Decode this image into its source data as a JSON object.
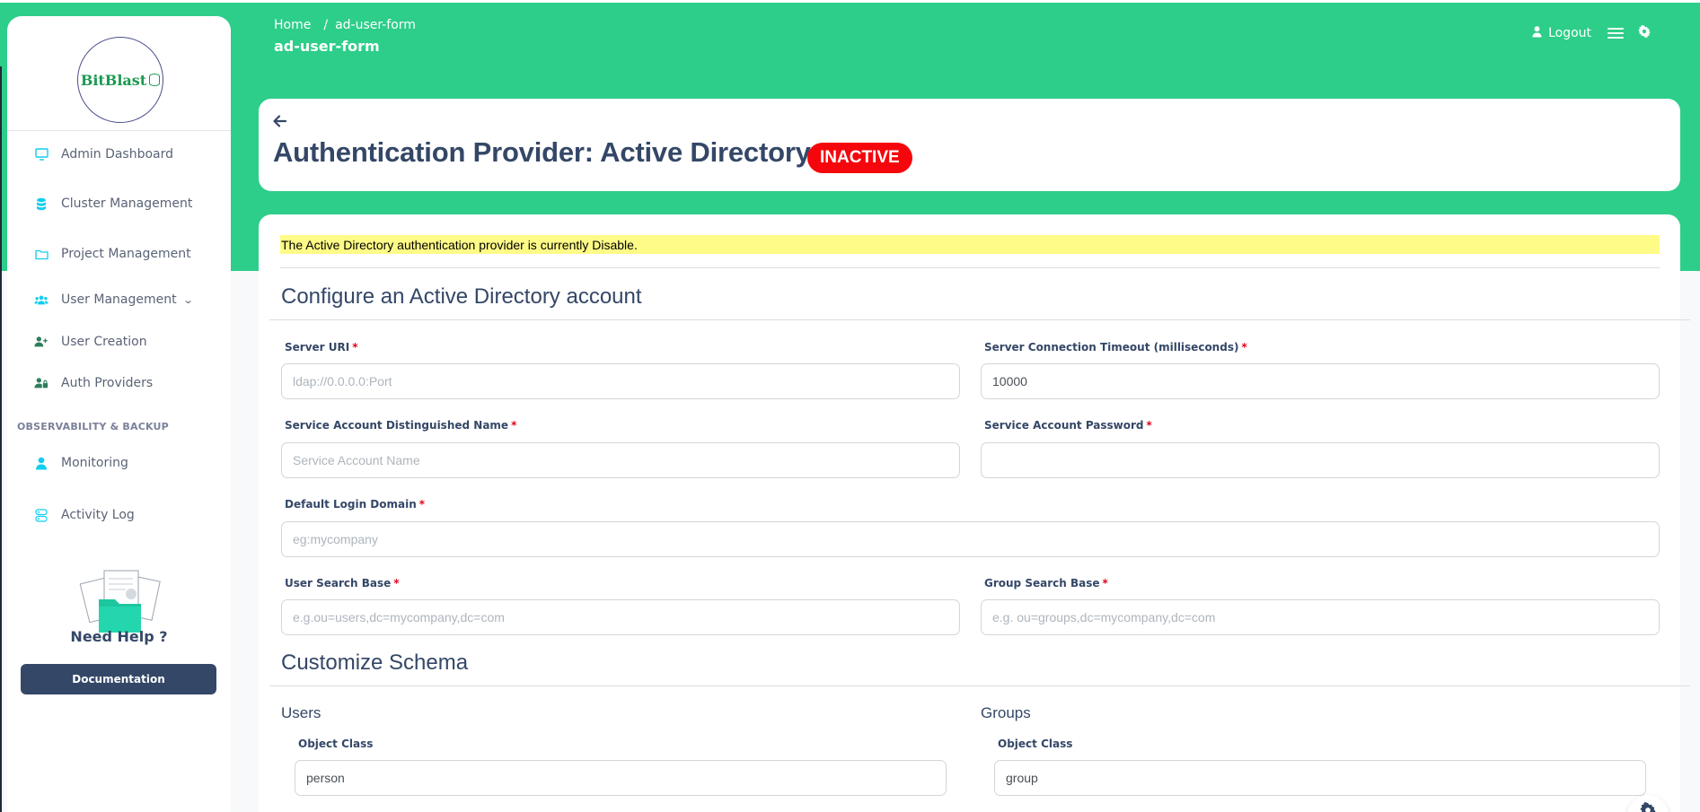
{
  "breadcrumb": {
    "home": "Home",
    "separator": "/",
    "current": "ad-user-form"
  },
  "page_heading": "ad-user-form",
  "top_bar": {
    "logout_label": "Logout"
  },
  "logo": {
    "text": "BitBlast"
  },
  "sidebar": {
    "items": [
      {
        "label": "Admin Dashboard",
        "icon": "monitor-icon"
      },
      {
        "label": "Cluster Management",
        "icon": "database-icon"
      },
      {
        "label": "Project Management",
        "icon": "folder-icon"
      },
      {
        "label": "User Management",
        "icon": "users-icon"
      },
      {
        "label": "User Creation",
        "icon": "user-plus-icon"
      },
      {
        "label": "Auth Providers",
        "icon": "user-lock-icon"
      },
      {
        "label": "Monitoring",
        "icon": "user-icon"
      },
      {
        "label": "Activity Log",
        "icon": "log-icon"
      }
    ],
    "section_heading": "OBSERVABILITY & BACKUP",
    "need_help": "Need Help ?",
    "documentation_label": "Documentation"
  },
  "header": {
    "title": "Authentication Provider: Active Directory",
    "status_badge": "INACTIVE"
  },
  "alert": {
    "text": "The Active Directory authentication provider is currently Disable."
  },
  "configure_section": {
    "title": "Configure an Active Directory account",
    "fields": {
      "server_uri": {
        "label": "Server URI",
        "value": "",
        "placeholder": "ldap://0.0.0.0:Port"
      },
      "timeout": {
        "label": "Server Connection Timeout (milliseconds)",
        "value": "10000",
        "placeholder": ""
      },
      "service_dn": {
        "label": "Service Account Distinguished Name",
        "value": "",
        "placeholder": "Service Account Name"
      },
      "service_password": {
        "label": "Service Account Password",
        "value": "",
        "placeholder": ""
      },
      "login_domain": {
        "label": "Default Login Domain",
        "value": "",
        "placeholder": "eg:mycompany"
      },
      "user_search_base": {
        "label": "User Search Base",
        "value": "",
        "placeholder": "e.g.ou=users,dc=mycompany,dc=com"
      },
      "group_search_base": {
        "label": "Group Search Base",
        "value": "",
        "placeholder": "e.g. ou=groups,dc=mycompany,dc=com"
      }
    },
    "required_mark": "*"
  },
  "schema_section": {
    "title": "Customize Schema",
    "users": {
      "heading": "Users",
      "object_class_label": "Object Class",
      "object_class_value": "person"
    },
    "groups": {
      "heading": "Groups",
      "object_class_label": "Object Class",
      "object_class_value": "group"
    }
  },
  "colors": {
    "brand_green": "#2dce89",
    "badge_red": "#f5060c",
    "alert_yellow": "#fffb87",
    "primary_dark": "#344767"
  }
}
